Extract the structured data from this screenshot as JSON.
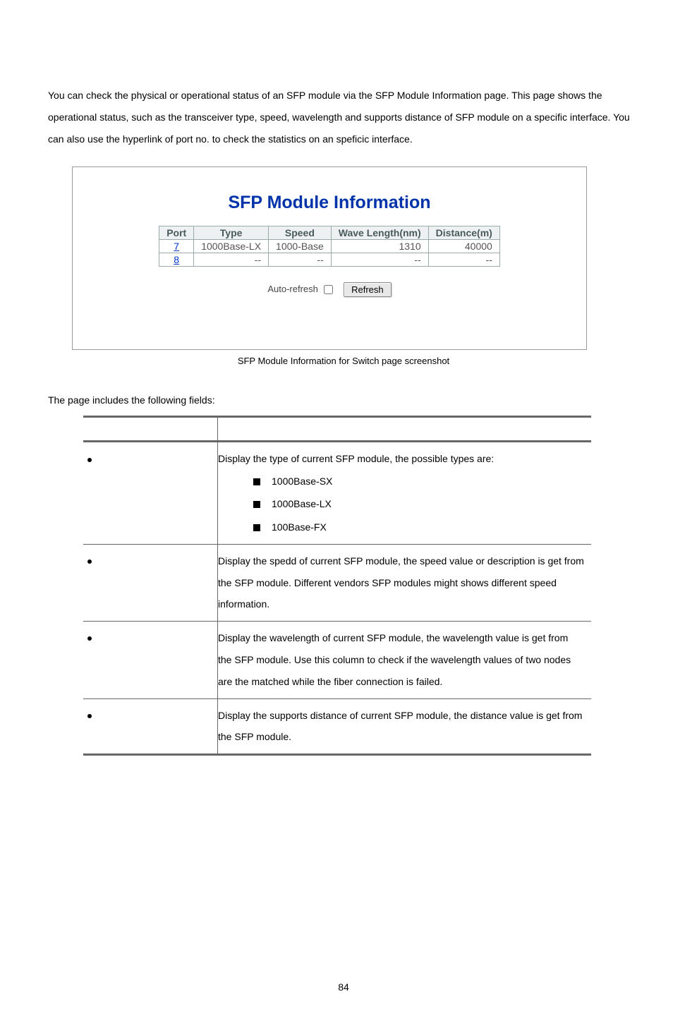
{
  "intro": "You can check the physical or operational status of an SFP module via the SFP Module Information page. This page shows the operational status, such as the transceiver type, speed, wavelength and supports distance of SFP module on a specific interface. You can also use the hyperlink of port no. to check the statistics on an speficic interface.",
  "screenshot": {
    "title": "SFP Module Information",
    "headers": {
      "port": "Port",
      "type": "Type",
      "speed": "Speed",
      "wave": "Wave Length(nm)",
      "dist": "Distance(m)"
    },
    "rows": [
      {
        "port": "7",
        "type": "1000Base-LX",
        "speed": "1000-Base",
        "wave": "1310",
        "dist": "40000"
      },
      {
        "port": "8",
        "type": "--",
        "speed": "--",
        "wave": "--",
        "dist": "--"
      }
    ],
    "auto_refresh_label": "Auto-refresh",
    "refresh_label": "Refresh"
  },
  "caption": "SFP Module Information for Switch page screenshot",
  "fields_intro": "The page includes the following fields:",
  "fields": [
    {
      "desc_pre": "Display the type of current SFP module, the possible types are:",
      "items": [
        "1000Base-SX",
        "1000Base-LX",
        "100Base-FX"
      ]
    },
    {
      "desc": "Display the spedd of current SFP module, the speed value or description is get from the SFP module. Different vendors SFP modules might shows different speed information."
    },
    {
      "desc": "Display the wavelength of current SFP module, the wavelength value is get from the SFP module. Use this column to check if the wavelength values of two nodes are the matched while the fiber connection is failed."
    },
    {
      "desc": "Display the supports distance of current SFP module, the distance value is get from the SFP module."
    }
  ],
  "page_number": "84"
}
